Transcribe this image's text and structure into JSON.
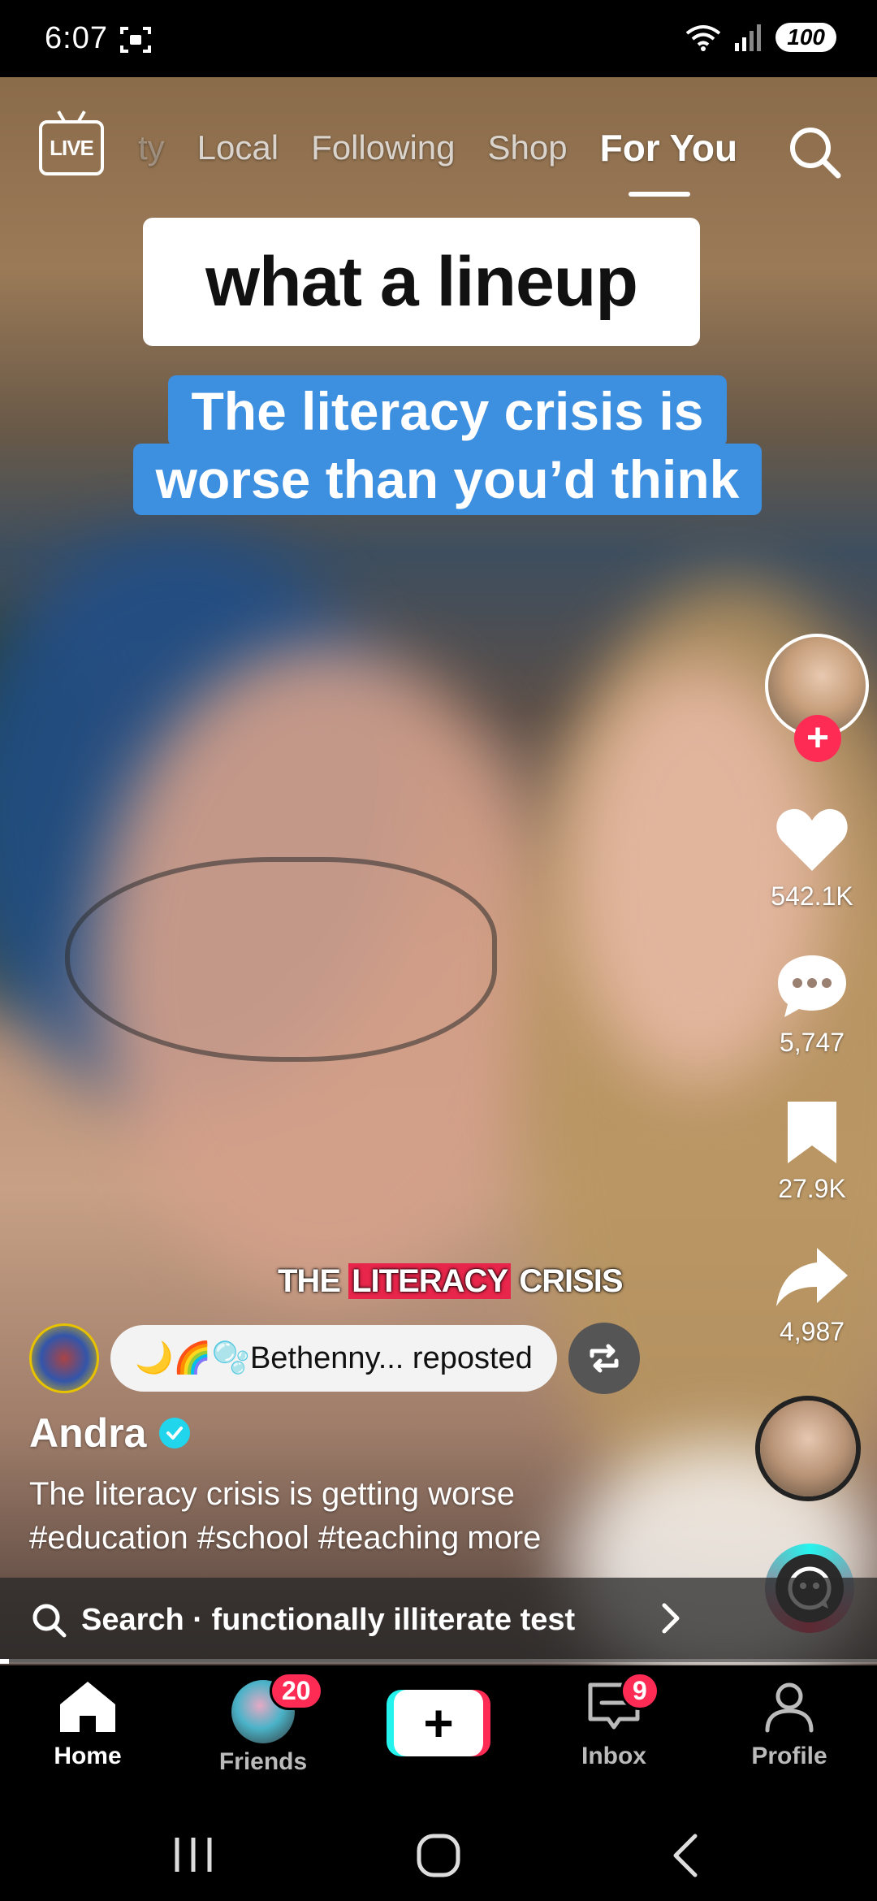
{
  "status_bar": {
    "time": "6:07",
    "battery": "100",
    "network": "6"
  },
  "top_nav": {
    "live_label": "LIVE",
    "tabs": [
      {
        "label": "ty"
      },
      {
        "label": "Local"
      },
      {
        "label": "Following"
      },
      {
        "label": "Shop"
      },
      {
        "label": "For You"
      }
    ],
    "active_tab": "For You"
  },
  "captions": {
    "white": "what a lineup",
    "blue_line1": "The literacy crisis is",
    "blue_line2": "worse than you’d think"
  },
  "video_subtitle": {
    "pre": "THE ",
    "highlight": "LITERACY",
    "post": " CRISIS"
  },
  "actions": {
    "likes": "542.1K",
    "comments": "5,747",
    "saves": "27.9K",
    "shares": "4,987"
  },
  "repost": {
    "text": "🌙🌈🫧Bethenny... reposted"
  },
  "author": {
    "name": "Andra",
    "verified": true
  },
  "description": {
    "text": "The literacy crisis is getting worse",
    "tags": "#education #school #teaching",
    "more": "more"
  },
  "search_suggestion": {
    "label": "Search · functionally illiterate test"
  },
  "playback_progress": 0.01,
  "bottom_nav": {
    "home": "Home",
    "friends": "Friends",
    "friends_badge": "20",
    "inbox": "Inbox",
    "inbox_badge": "9",
    "profile": "Profile"
  },
  "colors": {
    "accent": "#fe2c55",
    "cyan": "#25f4ee",
    "caption_blue": "#3d8fe0",
    "verified": "#20d5ec"
  }
}
